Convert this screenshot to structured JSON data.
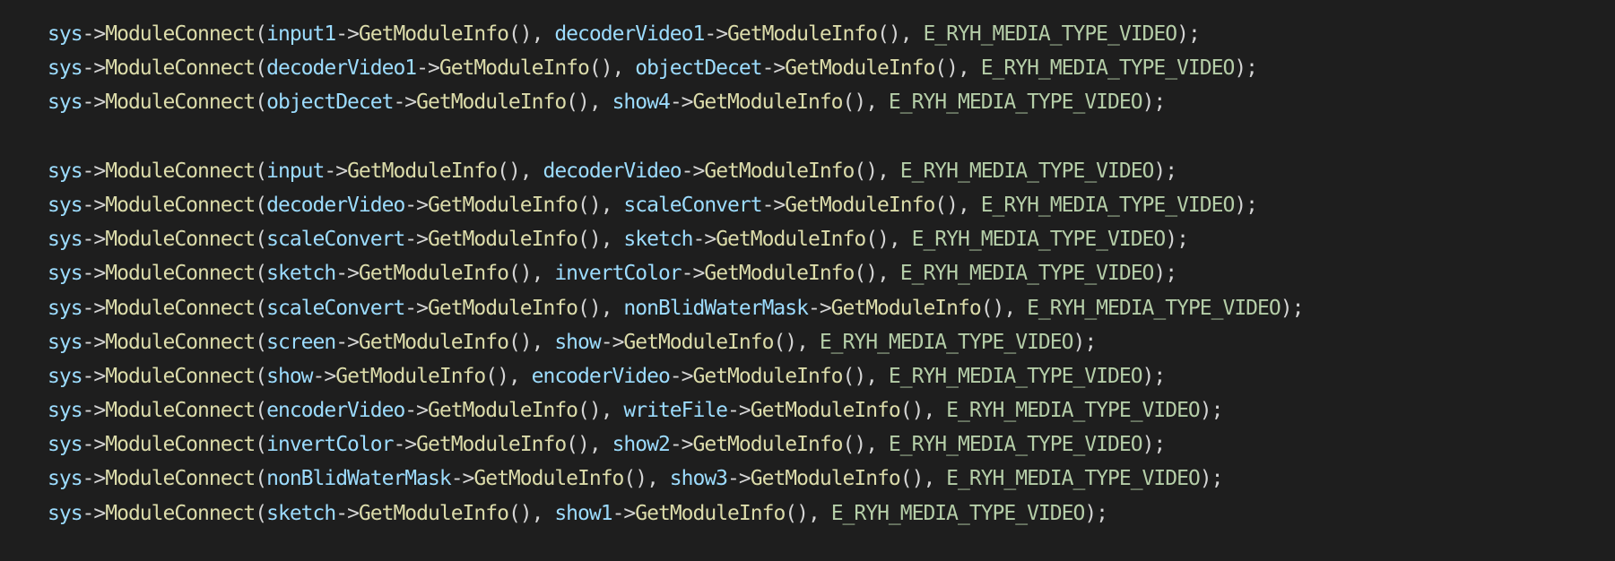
{
  "editor": {
    "theme_colors": {
      "background": "#1e1e1e",
      "variable": "#9cdcfe",
      "operator": "#d4d4d4",
      "function": "#dcdcaa",
      "enum_constant": "#b5cea8"
    },
    "lines": [
      {
        "segs": [
          [
            "var",
            "sys"
          ],
          [
            "op",
            "->"
          ],
          [
            "fn",
            "ModuleConnect"
          ],
          [
            "op",
            "("
          ],
          [
            "var",
            "input1"
          ],
          [
            "op",
            "->"
          ],
          [
            "fn",
            "GetModuleInfo"
          ],
          [
            "op",
            "(), "
          ],
          [
            "var",
            "decoderVideo1"
          ],
          [
            "op",
            "->"
          ],
          [
            "fn",
            "GetModuleInfo"
          ],
          [
            "op",
            "(), "
          ],
          [
            "enum",
            "E_RYH_MEDIA_TYPE_VIDEO"
          ],
          [
            "op",
            ");"
          ]
        ]
      },
      {
        "segs": [
          [
            "var",
            "sys"
          ],
          [
            "op",
            "->"
          ],
          [
            "fn",
            "ModuleConnect"
          ],
          [
            "op",
            "("
          ],
          [
            "var",
            "decoderVideo1"
          ],
          [
            "op",
            "->"
          ],
          [
            "fn",
            "GetModuleInfo"
          ],
          [
            "op",
            "(), "
          ],
          [
            "var",
            "objectDecet"
          ],
          [
            "op",
            "->"
          ],
          [
            "fn",
            "GetModuleInfo"
          ],
          [
            "op",
            "(), "
          ],
          [
            "enum",
            "E_RYH_MEDIA_TYPE_VIDEO"
          ],
          [
            "op",
            ");"
          ]
        ]
      },
      {
        "segs": [
          [
            "var",
            "sys"
          ],
          [
            "op",
            "->"
          ],
          [
            "fn",
            "ModuleConnect"
          ],
          [
            "op",
            "("
          ],
          [
            "var",
            "objectDecet"
          ],
          [
            "op",
            "->"
          ],
          [
            "fn",
            "GetModuleInfo"
          ],
          [
            "op",
            "(), "
          ],
          [
            "var",
            "show4"
          ],
          [
            "op",
            "->"
          ],
          [
            "fn",
            "GetModuleInfo"
          ],
          [
            "op",
            "(), "
          ],
          [
            "enum",
            "E_RYH_MEDIA_TYPE_VIDEO"
          ],
          [
            "op",
            ");"
          ]
        ]
      },
      {
        "segs": []
      },
      {
        "segs": [
          [
            "var",
            "sys"
          ],
          [
            "op",
            "->"
          ],
          [
            "fn",
            "ModuleConnect"
          ],
          [
            "op",
            "("
          ],
          [
            "var",
            "input"
          ],
          [
            "op",
            "->"
          ],
          [
            "fn",
            "GetModuleInfo"
          ],
          [
            "op",
            "(), "
          ],
          [
            "var",
            "decoderVideo"
          ],
          [
            "op",
            "->"
          ],
          [
            "fn",
            "GetModuleInfo"
          ],
          [
            "op",
            "(), "
          ],
          [
            "enum",
            "E_RYH_MEDIA_TYPE_VIDEO"
          ],
          [
            "op",
            ");"
          ]
        ]
      },
      {
        "segs": [
          [
            "var",
            "sys"
          ],
          [
            "op",
            "->"
          ],
          [
            "fn",
            "ModuleConnect"
          ],
          [
            "op",
            "("
          ],
          [
            "var",
            "decoderVideo"
          ],
          [
            "op",
            "->"
          ],
          [
            "fn",
            "GetModuleInfo"
          ],
          [
            "op",
            "(), "
          ],
          [
            "var",
            "scaleConvert"
          ],
          [
            "op",
            "->"
          ],
          [
            "fn",
            "GetModuleInfo"
          ],
          [
            "op",
            "(), "
          ],
          [
            "enum",
            "E_RYH_MEDIA_TYPE_VIDEO"
          ],
          [
            "op",
            ");"
          ]
        ]
      },
      {
        "segs": [
          [
            "var",
            "sys"
          ],
          [
            "op",
            "->"
          ],
          [
            "fn",
            "ModuleConnect"
          ],
          [
            "op",
            "("
          ],
          [
            "var",
            "scaleConvert"
          ],
          [
            "op",
            "->"
          ],
          [
            "fn",
            "GetModuleInfo"
          ],
          [
            "op",
            "(), "
          ],
          [
            "var",
            "sketch"
          ],
          [
            "op",
            "->"
          ],
          [
            "fn",
            "GetModuleInfo"
          ],
          [
            "op",
            "(), "
          ],
          [
            "enum",
            "E_RYH_MEDIA_TYPE_VIDEO"
          ],
          [
            "op",
            ");"
          ]
        ]
      },
      {
        "segs": [
          [
            "var",
            "sys"
          ],
          [
            "op",
            "->"
          ],
          [
            "fn",
            "ModuleConnect"
          ],
          [
            "op",
            "("
          ],
          [
            "var",
            "sketch"
          ],
          [
            "op",
            "->"
          ],
          [
            "fn",
            "GetModuleInfo"
          ],
          [
            "op",
            "(), "
          ],
          [
            "var",
            "invertColor"
          ],
          [
            "op",
            "->"
          ],
          [
            "fn",
            "GetModuleInfo"
          ],
          [
            "op",
            "(), "
          ],
          [
            "enum",
            "E_RYH_MEDIA_TYPE_VIDEO"
          ],
          [
            "op",
            ");"
          ]
        ]
      },
      {
        "segs": [
          [
            "var",
            "sys"
          ],
          [
            "op",
            "->"
          ],
          [
            "fn",
            "ModuleConnect"
          ],
          [
            "op",
            "("
          ],
          [
            "var",
            "scaleConvert"
          ],
          [
            "op",
            "->"
          ],
          [
            "fn",
            "GetModuleInfo"
          ],
          [
            "op",
            "(), "
          ],
          [
            "var",
            "nonBlidWaterMask"
          ],
          [
            "op",
            "->"
          ],
          [
            "fn",
            "GetModuleInfo"
          ],
          [
            "op",
            "(), "
          ],
          [
            "enum",
            "E_RYH_MEDIA_TYPE_VIDEO"
          ],
          [
            "op",
            ");"
          ]
        ]
      },
      {
        "segs": [
          [
            "var",
            "sys"
          ],
          [
            "op",
            "->"
          ],
          [
            "fn",
            "ModuleConnect"
          ],
          [
            "op",
            "("
          ],
          [
            "var",
            "screen"
          ],
          [
            "op",
            "->"
          ],
          [
            "fn",
            "GetModuleInfo"
          ],
          [
            "op",
            "(), "
          ],
          [
            "var",
            "show"
          ],
          [
            "op",
            "->"
          ],
          [
            "fn",
            "GetModuleInfo"
          ],
          [
            "op",
            "(), "
          ],
          [
            "enum",
            "E_RYH_MEDIA_TYPE_VIDEO"
          ],
          [
            "op",
            ");"
          ]
        ]
      },
      {
        "segs": [
          [
            "var",
            "sys"
          ],
          [
            "op",
            "->"
          ],
          [
            "fn",
            "ModuleConnect"
          ],
          [
            "op",
            "("
          ],
          [
            "var",
            "show"
          ],
          [
            "op",
            "->"
          ],
          [
            "fn",
            "GetModuleInfo"
          ],
          [
            "op",
            "(), "
          ],
          [
            "var",
            "encoderVideo"
          ],
          [
            "op",
            "->"
          ],
          [
            "fn",
            "GetModuleInfo"
          ],
          [
            "op",
            "(), "
          ],
          [
            "enum",
            "E_RYH_MEDIA_TYPE_VIDEO"
          ],
          [
            "op",
            ");"
          ]
        ]
      },
      {
        "segs": [
          [
            "var",
            "sys"
          ],
          [
            "op",
            "->"
          ],
          [
            "fn",
            "ModuleConnect"
          ],
          [
            "op",
            "("
          ],
          [
            "var",
            "encoderVideo"
          ],
          [
            "op",
            "->"
          ],
          [
            "fn",
            "GetModuleInfo"
          ],
          [
            "op",
            "(), "
          ],
          [
            "var",
            "writeFile"
          ],
          [
            "op",
            "->"
          ],
          [
            "fn",
            "GetModuleInfo"
          ],
          [
            "op",
            "(), "
          ],
          [
            "enum",
            "E_RYH_MEDIA_TYPE_VIDEO"
          ],
          [
            "op",
            ");"
          ]
        ]
      },
      {
        "segs": [
          [
            "var",
            "sys"
          ],
          [
            "op",
            "->"
          ],
          [
            "fn",
            "ModuleConnect"
          ],
          [
            "op",
            "("
          ],
          [
            "var",
            "invertColor"
          ],
          [
            "op",
            "->"
          ],
          [
            "fn",
            "GetModuleInfo"
          ],
          [
            "op",
            "(), "
          ],
          [
            "var",
            "show2"
          ],
          [
            "op",
            "->"
          ],
          [
            "fn",
            "GetModuleInfo"
          ],
          [
            "op",
            "(), "
          ],
          [
            "enum",
            "E_RYH_MEDIA_TYPE_VIDEO"
          ],
          [
            "op",
            ");"
          ]
        ]
      },
      {
        "segs": [
          [
            "var",
            "sys"
          ],
          [
            "op",
            "->"
          ],
          [
            "fn",
            "ModuleConnect"
          ],
          [
            "op",
            "("
          ],
          [
            "var",
            "nonBlidWaterMask"
          ],
          [
            "op",
            "->"
          ],
          [
            "fn",
            "GetModuleInfo"
          ],
          [
            "op",
            "(), "
          ],
          [
            "var",
            "show3"
          ],
          [
            "op",
            "->"
          ],
          [
            "fn",
            "GetModuleInfo"
          ],
          [
            "op",
            "(), "
          ],
          [
            "enum",
            "E_RYH_MEDIA_TYPE_VIDEO"
          ],
          [
            "op",
            ");"
          ]
        ]
      },
      {
        "segs": [
          [
            "var",
            "sys"
          ],
          [
            "op",
            "->"
          ],
          [
            "fn",
            "ModuleConnect"
          ],
          [
            "op",
            "("
          ],
          [
            "var",
            "sketch"
          ],
          [
            "op",
            "->"
          ],
          [
            "fn",
            "GetModuleInfo"
          ],
          [
            "op",
            "(), "
          ],
          [
            "var",
            "show1"
          ],
          [
            "op",
            "->"
          ],
          [
            "fn",
            "GetModuleInfo"
          ],
          [
            "op",
            "(), "
          ],
          [
            "enum",
            "E_RYH_MEDIA_TYPE_VIDEO"
          ],
          [
            "op",
            ");"
          ]
        ]
      }
    ]
  }
}
